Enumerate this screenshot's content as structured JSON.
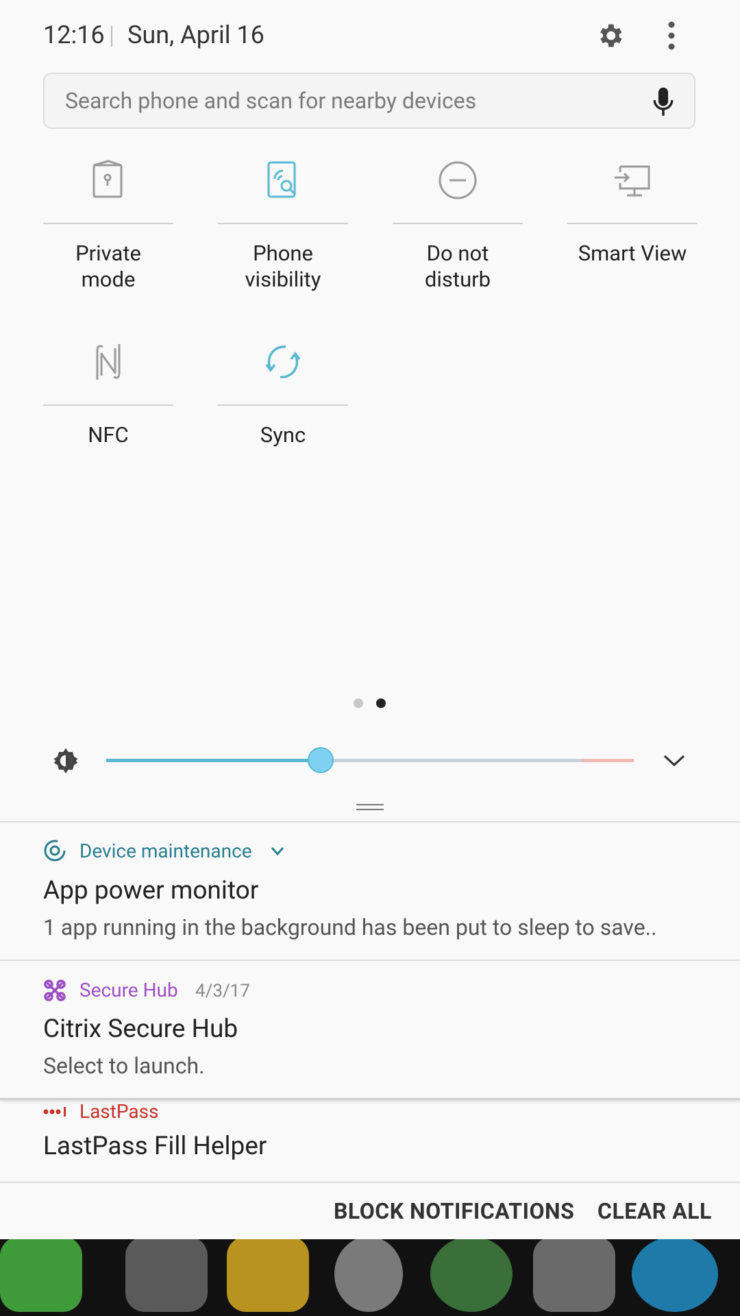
{
  "status": {
    "time": "12:16",
    "date": "Sun, April 16"
  },
  "search": {
    "placeholder": "Search phone and scan for nearby devices"
  },
  "tiles": [
    {
      "label": "Private\nmode",
      "icon": "private-mode-icon",
      "active": false
    },
    {
      "label": "Phone\nvisibility",
      "icon": "phone-visibility-icon",
      "active": true
    },
    {
      "label": "Do not\ndisturb",
      "icon": "do-not-disturb-icon",
      "active": false
    },
    {
      "label": "Smart View",
      "icon": "smart-view-icon",
      "active": false
    },
    {
      "label": "NFC",
      "icon": "nfc-icon",
      "active": false
    },
    {
      "label": "Sync",
      "icon": "sync-icon",
      "active": true
    }
  ],
  "pager": {
    "pages": 2,
    "current": 2
  },
  "brightness": {
    "level": 0.41
  },
  "notifications": [
    {
      "app": "Device maintenance",
      "app_color": "#2a7f8f",
      "title": "App power monitor",
      "body": "1 app running in the background has been put to sleep to save.."
    },
    {
      "app": "Secure Hub",
      "app_color": "#9b4fc1",
      "date": "4/3/17",
      "title": "Citrix Secure Hub",
      "body": "Select to launch."
    },
    {
      "app": "LastPass",
      "app_color": "#c8322b",
      "title": "LastPass Fill Helper"
    }
  ],
  "footer": {
    "block": "BLOCK NOTIFICATIONS",
    "clear": "CLEAR ALL"
  },
  "colors": {
    "accent": "#5bb8d3",
    "icon_grey": "#9a9a9a"
  }
}
